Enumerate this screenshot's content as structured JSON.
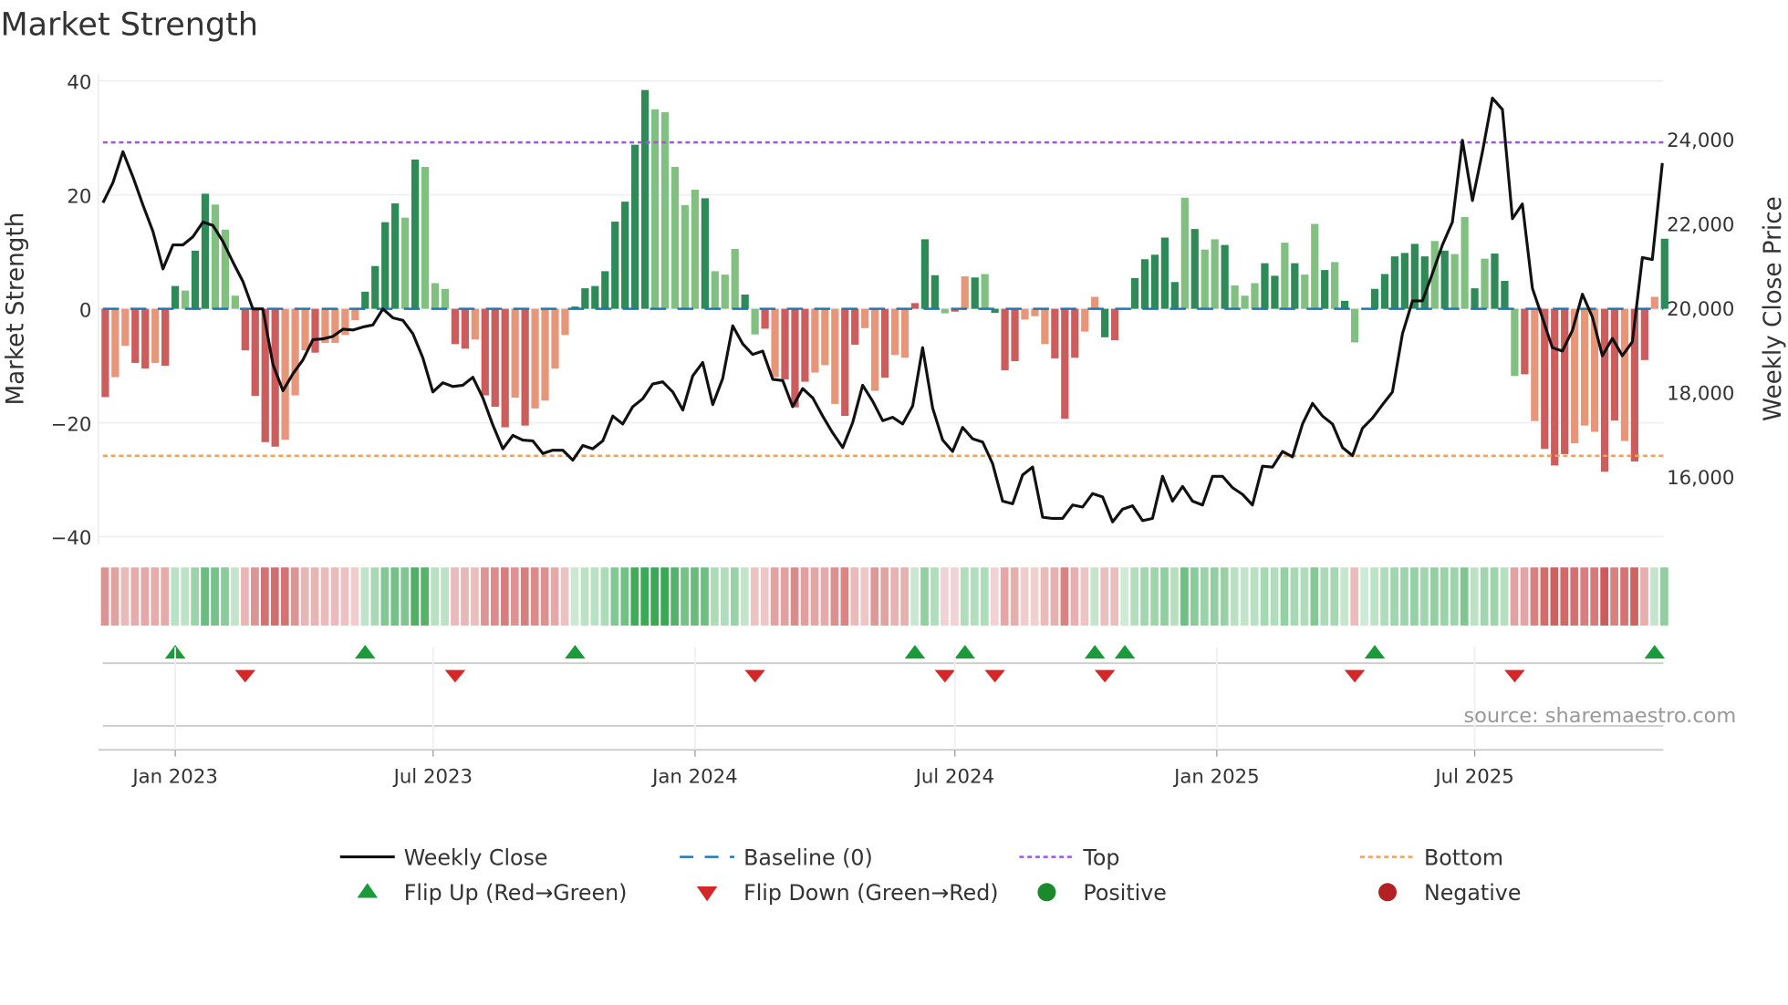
{
  "title": "Market Strength",
  "source": "source: sharemaestro.com",
  "colors": {
    "dark_green": "#2e8b57",
    "light_green": "#82c082",
    "dark_red": "#cd5c5c",
    "light_red": "#e8967a",
    "baseline": "#1f77b4",
    "top": "#9b59e0",
    "bottom": "#f0a060",
    "line": "#111111",
    "flip_up": "#1a9a3a",
    "flip_down": "#d62728",
    "pos": "#1a8a2a",
    "neg": "#b22222"
  },
  "chart_data": {
    "type": "bar",
    "title": "Market Strength",
    "ylabel": "Market Strength",
    "y2label": "Weekly Close Price",
    "ylim": [
      -41,
      41
    ],
    "y2lim": [
      14500,
      25300
    ],
    "yticks": [
      {
        "v": 40,
        "l": "40"
      },
      {
        "v": 20,
        "l": "20"
      },
      {
        "v": 0,
        "l": "0"
      },
      {
        "v": -20,
        "l": "−20"
      },
      {
        "v": -40,
        "l": "−40"
      }
    ],
    "y2ticks": [
      {
        "v": 24000,
        "l": "24,000"
      },
      {
        "v": 22000,
        "l": "22,000"
      },
      {
        "v": 20000,
        "l": "20,000"
      },
      {
        "v": 18000,
        "l": "18,000"
      },
      {
        "v": 16000,
        "l": "16,000"
      }
    ],
    "xticks": [
      {
        "w": 7,
        "l": "Jan 2023"
      },
      {
        "w": 32.8,
        "l": "Jul 2023"
      },
      {
        "w": 59,
        "l": "Jan 2024"
      },
      {
        "w": 85,
        "l": "Jul 2024"
      },
      {
        "w": 111.2,
        "l": "Jan 2025"
      },
      {
        "w": 137,
        "l": "Jul 2025"
      }
    ],
    "top": 29.2,
    "bottom": -25.8,
    "strength": [
      -15.5,
      -12,
      -6.5,
      -9.5,
      -10.5,
      -9.5,
      -10,
      4,
      3.2,
      10.2,
      20.2,
      18.3,
      13.9,
      2.3,
      -7.3,
      -15.3,
      -23.4,
      -24.2,
      -23,
      -15.2,
      -7.3,
      -7.7,
      -6,
      -6,
      -4.6,
      -2,
      3,
      7.5,
      15.2,
      18.5,
      16,
      26.2,
      24.9,
      4.5,
      3.5,
      -6.2,
      -7,
      -5.4,
      -15.2,
      -17.2,
      -20.8,
      -15.6,
      -20.5,
      -17.5,
      -16.1,
      -10.5,
      -4.6,
      0.4,
      3.6,
      4,
      6.6,
      15.3,
      18.8,
      28.8,
      38.4,
      35,
      34.5,
      24.9,
      18.2,
      20.9,
      19.4,
      6.6,
      6,
      10.5,
      2.5,
      -4.5,
      -3.5,
      -12,
      -12.4,
      -17.3,
      -12.8,
      -11.2,
      -9.9,
      -16.7,
      -18.8,
      -6.3,
      -3.4,
      -14.4,
      -12.1,
      -8.1,
      -8.6,
      1,
      12.2,
      5.9,
      -0.8,
      -0.5,
      5.7,
      5.5,
      6.1,
      -0.7,
      -10.8,
      -9.2,
      -1.9,
      -1.3,
      -6.2,
      -8.7,
      -19.3,
      -8.6,
      -4,
      2.1,
      -5,
      -5.5,
      0,
      5.4,
      8.7,
      9.5,
      12.5,
      4.7,
      19.5,
      14,
      10.4,
      12.2,
      11.2,
      4.1,
      2.3,
      4.5,
      8,
      5.8,
      11.6,
      8,
      6,
      14.9,
      6.8,
      8.2,
      1.4,
      -5.9,
      0,
      3.5,
      6.1,
      9.2,
      9.8,
      11.4,
      9.2,
      11.9,
      10.2,
      9.6,
      16.1,
      3.6,
      8.8,
      9.7,
      4.9,
      -11.8,
      -11.5,
      -19.7,
      -24.6,
      -27.5,
      -25.5,
      -23.6,
      -20.5,
      -21.6,
      -28.6,
      -19.6,
      -23.2,
      -26.8,
      -9,
      2.1,
      12.3
    ],
    "shade": "RrrRRrRGgGGgggRRRRrrrRrrrrGGGGgGgggRRrRRRrRrrrrGGGGGGGGgggggGgggGgRrRRRrrrRRrrRrrRGGgRrGgGRRrrrRRRrrGRRGGGGGgGggGgggGGgGggGgGgRGGGGGGgGggGgGGgRrRRRrrrRRrRRrGG",
    "close": [
      22490,
      22970,
      23700,
      23100,
      22430,
      21810,
      20920,
      21490,
      21490,
      21680,
      22030,
      21950,
      21570,
      21080,
      20620,
      19970,
      19970,
      18650,
      18030,
      18430,
      18760,
      19240,
      19260,
      19320,
      19490,
      19470,
      19540,
      19590,
      19970,
      19760,
      19700,
      19380,
      18810,
      18000,
      18220,
      18130,
      18160,
      18350,
      17860,
      17220,
      16650,
      16970,
      16860,
      16840,
      16540,
      16620,
      16620,
      16380,
      16730,
      16650,
      16840,
      17430,
      17240,
      17650,
      17840,
      18190,
      18240,
      18000,
      17570,
      18380,
      18700,
      17700,
      18320,
      19570,
      19140,
      18890,
      18970,
      18300,
      18270,
      17650,
      18080,
      17860,
      17430,
      17030,
      16680,
      17270,
      18160,
      17780,
      17320,
      17400,
      17240,
      17670,
      19050,
      17620,
      16860,
      16590,
      17160,
      16890,
      16810,
      16300,
      15410,
      15350,
      16030,
      16220,
      15030,
      15000,
      15000,
      15320,
      15270,
      15590,
      15510,
      14920,
      15220,
      15300,
      14950,
      15000,
      16000,
      15410,
      15760,
      15410,
      15320,
      16000,
      16000,
      15730,
      15570,
      15320,
      16240,
      16220,
      16590,
      16460,
      17240,
      17730,
      17430,
      17240,
      16680,
      16490,
      17140,
      17380,
      17700,
      18000,
      19380,
      20160,
      20160,
      20810,
      21490,
      22030,
      23970,
      22540,
      23700,
      24970,
      24700,
      22110,
      22460,
      20460,
      19760,
      19050,
      18970,
      19460,
      20320,
      19780,
      18860,
      19270,
      18860,
      19190,
      21190,
      21140,
      23430
    ],
    "flip_up": [
      7,
      26,
      47,
      81,
      86,
      99,
      102,
      127,
      155
    ],
    "flip_down": [
      14,
      35,
      65,
      84,
      89,
      100,
      125,
      141
    ],
    "legend": {
      "weekly_close": "Weekly Close",
      "baseline": "Baseline (0)",
      "top": "Top",
      "bottom": "Bottom",
      "flip_up": "Flip Up (Red→Green)",
      "flip_down": "Flip Down (Green→Red)",
      "positive": "Positive",
      "negative": "Negative"
    }
  }
}
